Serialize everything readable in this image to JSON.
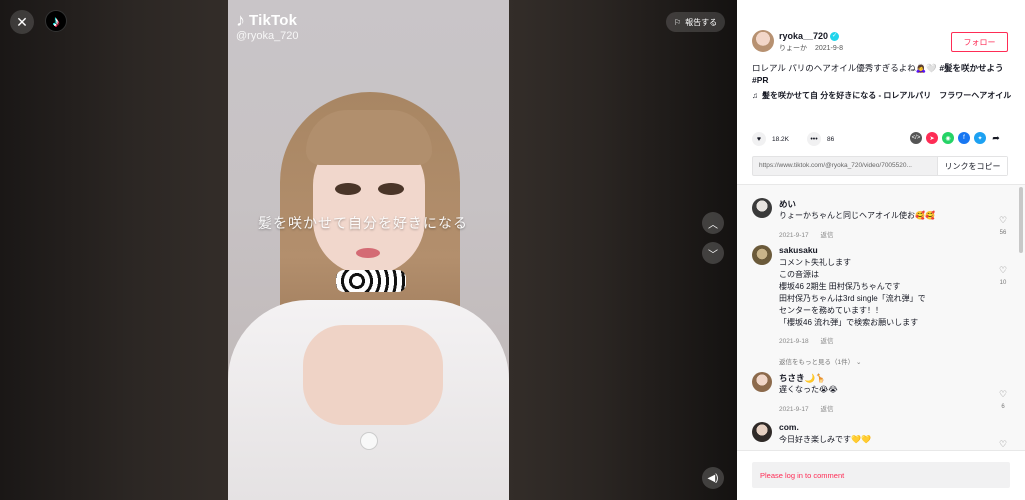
{
  "header": {
    "close_icon": "close-icon",
    "logo_icon": "tiktok-logo-icon",
    "report_label": "報告する"
  },
  "video": {
    "watermark_brand": "TikTok",
    "watermark_handle": "@ryoka_720",
    "caption": "髪を咲かせて自分を好きになる"
  },
  "author": {
    "username": "ryoka__720",
    "nickname": "りょーか",
    "date": "2021-9-8",
    "follow_label": "フォロー"
  },
  "description": {
    "text": "ロレアル パリのヘアオイル優秀すぎるよね🙇‍♀️🤍",
    "hashtag1": "#髪を咲かせよう",
    "hashtag2": "#PR"
  },
  "music": {
    "title": "髪を咲かせて自 分を好きになる - ロレアルパリ　フラワーヘアオイル"
  },
  "stats": {
    "likes": "18.2K",
    "comments": "86"
  },
  "share": {
    "url": "https://www.tiktok.com/@ryoka_720/video/7005520...",
    "copy_label": "リンクをコピー",
    "colors": [
      "#555555",
      "#fe2c55",
      "#25d366",
      "#1877f2",
      "#1da1f2",
      "#161823"
    ]
  },
  "comments": [
    {
      "name": "めい",
      "text": "りょーかちゃんと同じヘアオイル使お🥰🥰",
      "date": "2021-9-17",
      "reply": "返信",
      "likes": "56"
    },
    {
      "name": "sakusaku",
      "text1": "コメント失礼します",
      "text2": "この音源は",
      "text3": "櫻坂46 2期生 田村保乃ちゃんです",
      "text4": "田村保乃ちゃんは3rd single「流れ弾」で",
      "text5": "センターを務めています！！",
      "text6": "「櫻坂46 流れ弾」で検索お願いします",
      "date": "2021-9-18",
      "reply": "返信",
      "likes": "10",
      "more": "返信をもっと見る（1件）"
    },
    {
      "name": "ちさき🌙🦒",
      "text": "遅くなった😭😭",
      "date": "2021-9-17",
      "reply": "返信",
      "likes": "6"
    },
    {
      "name": "com.",
      "text": "今日好き楽しみです💛💛",
      "likes": ""
    }
  ],
  "login": {
    "prompt": "Please log in to comment"
  }
}
